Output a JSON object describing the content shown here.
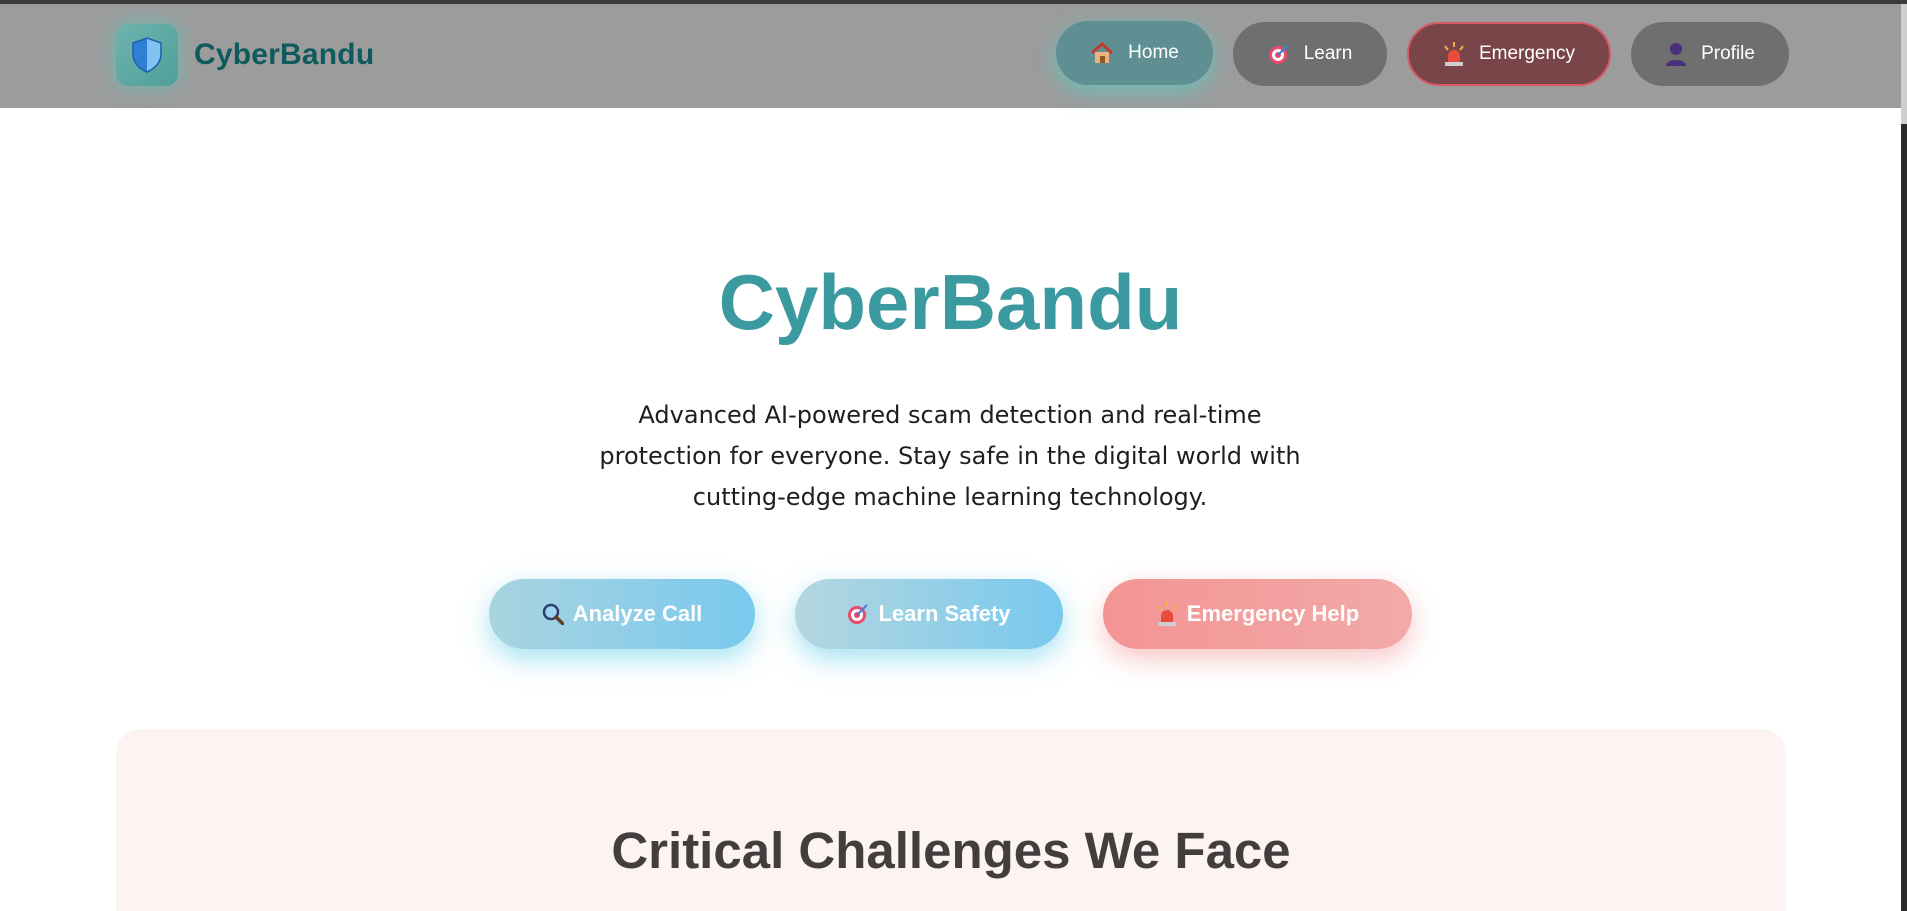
{
  "header": {
    "brand_name": "CyberBandu",
    "logo_icon": "shield-icon",
    "nav": [
      {
        "label": "Home",
        "icon": "house-icon"
      },
      {
        "label": "Learn",
        "icon": "target-icon"
      },
      {
        "label": "Emergency",
        "icon": "siren-icon"
      },
      {
        "label": "Profile",
        "icon": "user-icon"
      }
    ]
  },
  "hero": {
    "title": "CyberBandu",
    "subtitle_lines": [
      "Advanced AI-powered scam detection and real-time",
      "protection for everyone. Stay safe in the digital world with",
      "cutting-edge machine learning technology."
    ],
    "buttons": [
      {
        "label": "Analyze Call",
        "icon": "magnifier-icon"
      },
      {
        "label": "Learn Safety",
        "icon": "target-icon"
      },
      {
        "label": "Emergency Help",
        "icon": "siren-icon"
      }
    ]
  },
  "challenges": {
    "title": "Critical Challenges We Face"
  },
  "colors": {
    "navbar": "#9c9c9c",
    "brand_text": "#0f5a5c",
    "hero_title": "#3b9aa0",
    "home_active": "#5f8f92",
    "emergency_nav": "#7a4549",
    "cta_blue": "#79c9ee",
    "cta_red": "#f39494",
    "section_bg": "#fdf3f2"
  }
}
